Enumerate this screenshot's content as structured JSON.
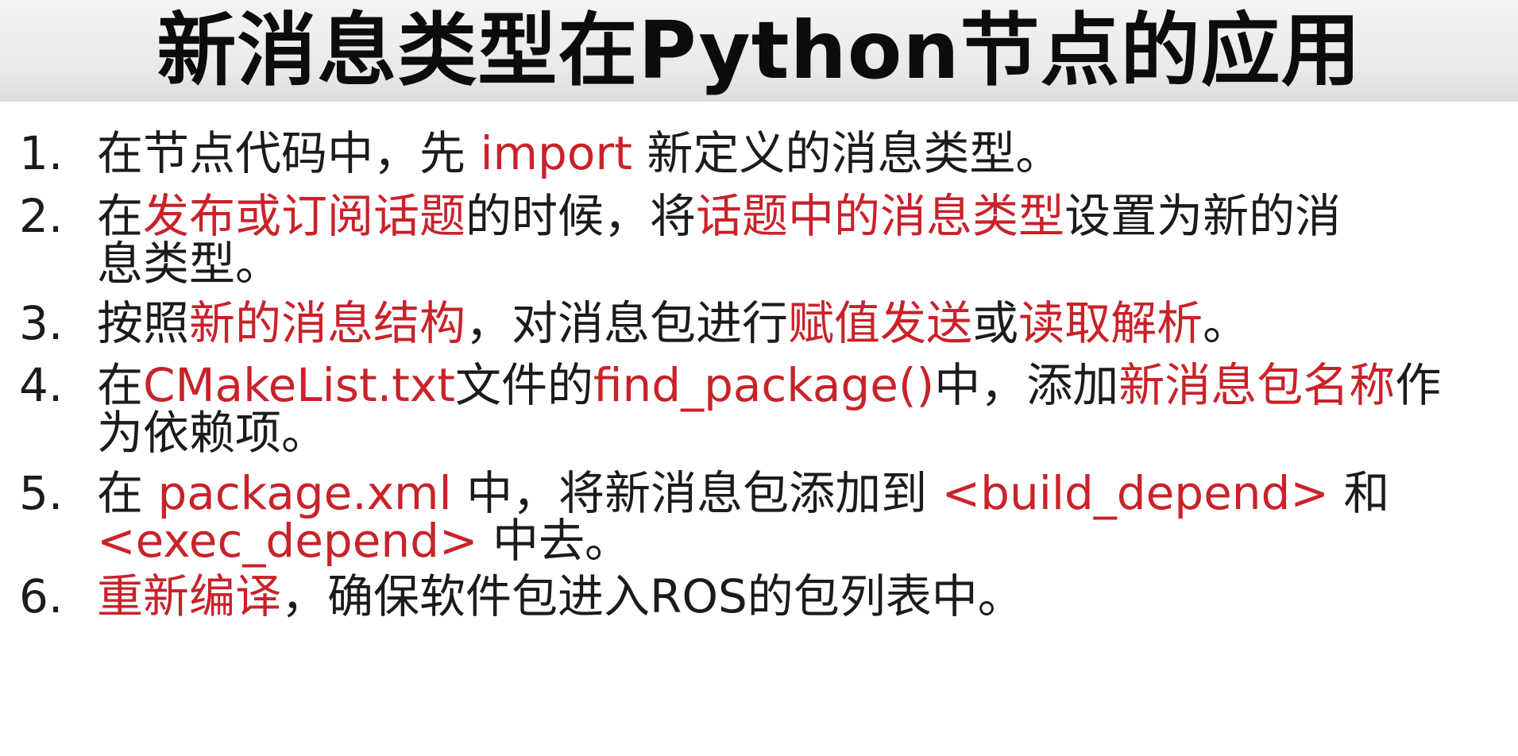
{
  "slide": {
    "title": "新消息类型在Python节点的应用"
  },
  "items": [
    {
      "number": "1.",
      "segments": [
        {
          "text": "在节点代码中，先 ",
          "color": "black"
        },
        {
          "text": "import",
          "color": "red"
        },
        {
          "text": " 新定义的消息类型。",
          "color": "black"
        }
      ]
    },
    {
      "number": "2.",
      "segments": [
        {
          "text": "在",
          "color": "black"
        },
        {
          "text": "发布或订阅话题",
          "color": "red"
        },
        {
          "text": "的时候，将",
          "color": "black"
        },
        {
          "text": "话题中的消息类型",
          "color": "red"
        },
        {
          "text": "设置为新的消",
          "color": "black"
        },
        {
          "text": "息类型。",
          "color": "black"
        }
      ]
    },
    {
      "number": "3.",
      "segments": [
        {
          "text": "按照",
          "color": "black"
        },
        {
          "text": "新的消息结构",
          "color": "red"
        },
        {
          "text": "，对消息包进行",
          "color": "black"
        },
        {
          "text": "赋值发送",
          "color": "red"
        },
        {
          "text": "或",
          "color": "black"
        },
        {
          "text": "读取解析",
          "color": "red"
        },
        {
          "text": "。",
          "color": "black"
        }
      ]
    },
    {
      "number": "4.",
      "segments": [
        {
          "text": "在",
          "color": "black"
        },
        {
          "text": "CMakeList.txt",
          "color": "red"
        },
        {
          "text": "文件的",
          "color": "black"
        },
        {
          "text": "find_package()",
          "color": "red"
        },
        {
          "text": "中，添加",
          "color": "black"
        },
        {
          "text": "新消息包名称",
          "color": "red"
        },
        {
          "text": "作",
          "color": "black"
        },
        {
          "text": "为依赖项。",
          "color": "black"
        }
      ]
    },
    {
      "number": "5.",
      "segments": [
        {
          "text": "在 ",
          "color": "black"
        },
        {
          "text": "package.xml",
          "color": "red"
        },
        {
          "text": " 中，将新消息包添加到 ",
          "color": "black"
        },
        {
          "text": "<build_depend>",
          "color": "red"
        },
        {
          "text": " 和",
          "color": "black"
        },
        {
          "text": "<exec_depend>",
          "color": "red"
        },
        {
          "text": " 中去。",
          "color": "black"
        }
      ]
    },
    {
      "number": "6.",
      "segments": [
        {
          "text": " 重新编译",
          "color": "red"
        },
        {
          "text": "，确保软件包进入ROS的包列表中。",
          "color": "black"
        }
      ]
    }
  ],
  "colors": {
    "text": "#1b1b1b",
    "highlight": "#c9222a",
    "title_band": "#e9e9e9"
  }
}
